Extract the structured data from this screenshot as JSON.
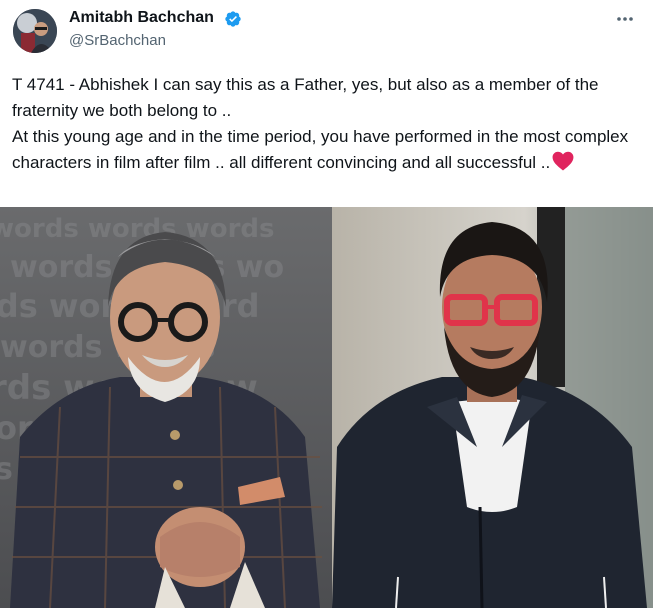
{
  "author": {
    "display_name": "Amitabh Bachchan",
    "handle": "@SrBachchan",
    "avatar_icon": "user-avatar",
    "verified_icon": "verified-badge-icon",
    "verified_color": "#1d9bf0"
  },
  "menu": {
    "icon": "more-options-icon"
  },
  "tweet": {
    "text": "T 4741 - Abhishek I can say this as a Father, yes, but also as a member of the fraternity we both belong to ..\nAt this young age and in the time period, you have performed in the most complex characters in film after film .. all different  convincing  and all successful ..",
    "emoji_icon": "red-heart-icon",
    "heart_color": "#e0245e"
  },
  "media": {
    "left_photo": {
      "subject": "older man with white beard and glasses in dark checked jacket",
      "backdrop_text": "words"
    },
    "right_photo": {
      "subject": "man with beard and red glasses in dark jacket"
    }
  }
}
